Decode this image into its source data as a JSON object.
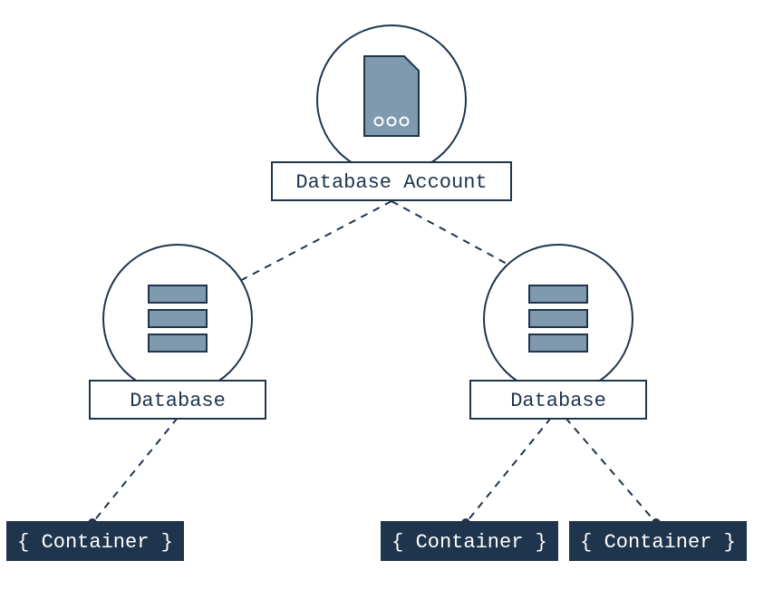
{
  "diagram": {
    "root": {
      "label": "Database Account",
      "icon": "document-icon"
    },
    "databases": [
      {
        "label": "Database",
        "icon": "stack-icon"
      },
      {
        "label": "Database",
        "icon": "stack-icon"
      }
    ],
    "containers": [
      {
        "label": "{ Container }"
      },
      {
        "label": "{ Container }"
      },
      {
        "label": "{ Container }"
      }
    ],
    "colors": {
      "stroke": "#1f344d",
      "iconFill": "#7f99af",
      "darkFill": "#1f344d",
      "light": "#ffffff"
    }
  }
}
